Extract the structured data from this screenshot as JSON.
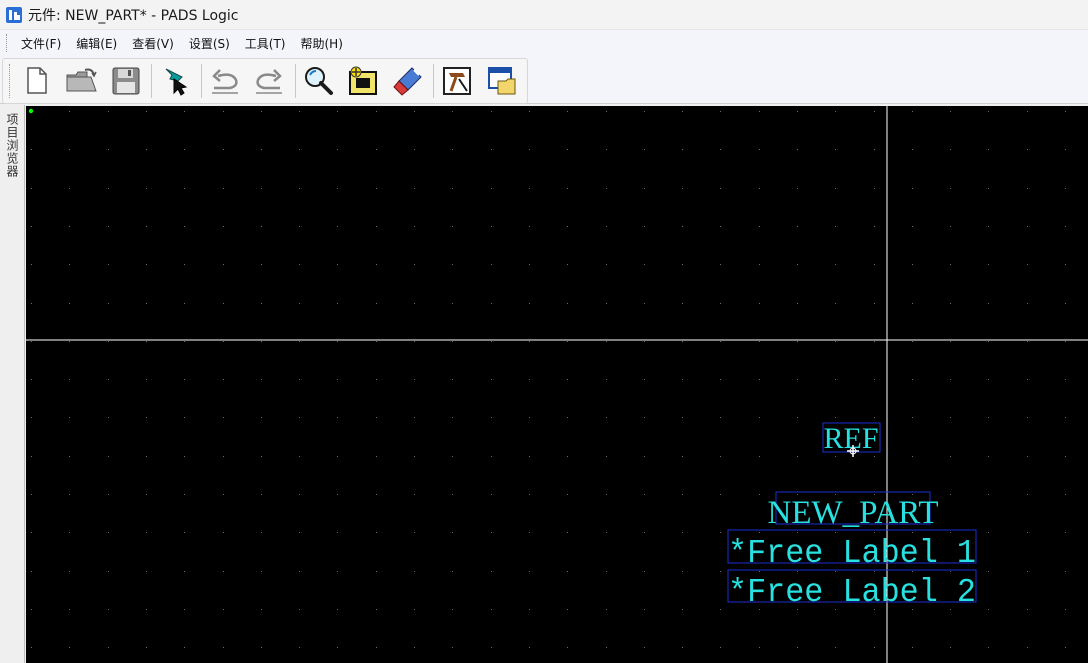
{
  "window": {
    "title": "元件: NEW_PART* - PADS Logic"
  },
  "menu": {
    "items": [
      {
        "label": "文件(F)",
        "name": "menu-file"
      },
      {
        "label": "编辑(E)",
        "name": "menu-edit"
      },
      {
        "label": "查看(V)",
        "name": "menu-view"
      },
      {
        "label": "设置(S)",
        "name": "menu-setup"
      },
      {
        "label": "工具(T)",
        "name": "menu-tools"
      },
      {
        "label": "帮助(H)",
        "name": "menu-help"
      }
    ]
  },
  "toolbar": {
    "buttons": [
      {
        "icon": "new-document-icon"
      },
      {
        "icon": "open-folder-icon"
      },
      {
        "icon": "save-disk-icon"
      },
      {
        "icon": "select-filter-icon"
      },
      {
        "icon": "undo-icon"
      },
      {
        "icon": "redo-icon"
      },
      {
        "icon": "zoom-icon"
      },
      {
        "icon": "add-terminal-icon"
      },
      {
        "icon": "edit-graphics-icon"
      },
      {
        "icon": "part-wizard-icon"
      },
      {
        "icon": "window-folder-icon"
      }
    ]
  },
  "side_panel": {
    "label": "项目浏览器"
  },
  "canvas": {
    "background": "#000000",
    "grid_color": "#6a6a6a",
    "crosshair_color": "#ffffff",
    "text_color": "#28e0e0",
    "box_color": "#1a2fd6",
    "origin_marker_color": "#00ff00",
    "labels": {
      "ref": "REF",
      "part_name": "NEW_PART",
      "free_label_1": "*Free Label 1",
      "free_label_2": "*Free Label 2"
    }
  }
}
